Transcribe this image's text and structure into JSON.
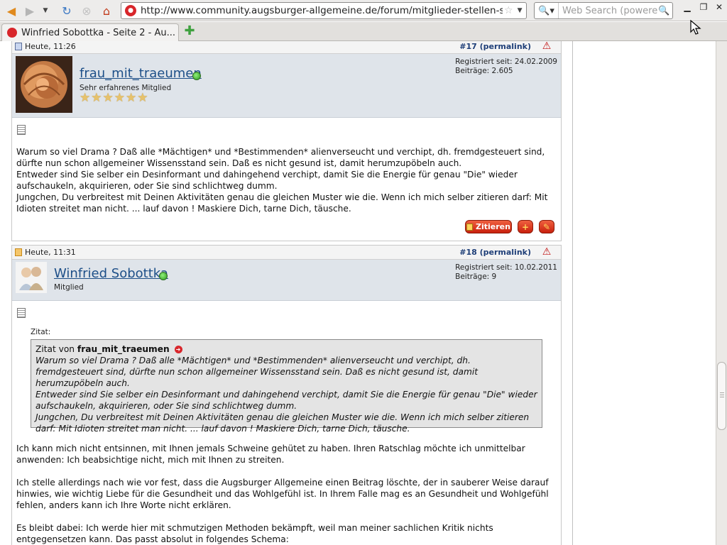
{
  "browser": {
    "url": "http://www.community.augsburger-allgemeine.de/forum/mitglieder-stellen-sic",
    "search_placeholder": "Web Search (powered",
    "tab_title": "Winfried Sobottka - Seite 2 - Au...",
    "icons": [
      "back-icon",
      "forward-icon",
      "history-dropdown-icon",
      "reload-icon",
      "stop-icon",
      "home-icon",
      "bookmark-star-icon",
      "search-engine-icon",
      "search-go-icon",
      "minimize-icon",
      "restore-icon",
      "close-icon",
      "new-tab-icon"
    ]
  },
  "posts": [
    {
      "date": "Heute, 11:26",
      "permalink": "#17 (permalink)",
      "username": "frau_mit_traeumen",
      "rank": "Sehr erfahrenes Mitglied",
      "stars": "★★★★★★",
      "registered": "Registriert seit: 24.02.2009",
      "posts_count": "Beiträge: 2.605",
      "paragraphs": [
        "Warum so viel Drama ? Daß alle *Mächtigen* und *Bestimmenden* alienverseucht und verchipt, dh. fremdgesteuert sind, dürfte nun schon allgemeiner Wissensstand sein. Daß es nicht gesund ist, damit herumzupöbeln auch.",
        "Entweder sind Sie selber ein Desinformant und dahingehend verchipt, damit Sie die Energie für genau \"Die\" wieder aufschaukeln, akquirieren, oder Sie sind schlichtweg dumm.",
        "Jungchen, Du verbreitest mit Deinen Aktivitäten genau die gleichen Muster wie die. Wenn ich mich selber zitieren darf: Mit Idioten streitet man nicht. ... lauf davon ! Maskiere Dich, tarne Dich, täusche."
      ],
      "quote_button": "Zitieren"
    },
    {
      "date": "Heute, 11:31",
      "permalink": "#18 (permalink)",
      "username": "Winfried Sobottka",
      "rank": "Mitglied",
      "registered": "Registriert seit: 10.02.2011",
      "posts_count": "Beiträge: 9",
      "quote_label": "Zitat:",
      "quote_prefix": "Zitat von",
      "quote_author": "frau_mit_traeumen",
      "quote_lines": [
        "Warum so viel Drama ? Daß alle *Mächtigen* und *Bestimmenden* alienverseucht und verchipt, dh. fremdgesteuert sind, dürfte nun schon allgemeiner Wissensstand sein. Daß es nicht gesund ist, damit herumzupöbeln auch.",
        "Entweder sind Sie selber ein Desinformant und dahingehend verchipt, damit Sie die Energie für genau \"Die\" wieder aufschaukeln, akquirieren, oder Sie sind schlichtweg dumm.",
        "Jungchen, Du verbreitest mit Deinen Aktivitäten genau die gleichen Muster wie die. Wenn ich mich selber zitieren darf: Mit Idioten streitet man nicht. ... lauf davon ! Maskiere Dich, tarne Dich, täusche."
      ],
      "paragraphs": [
        "Ich kann mich nicht entsinnen, mit Ihnen jemals Schweine gehütet zu haben. Ihren Ratschlag möchte ich unmittelbar anwenden: Ich beabsichtige nicht, mich mit Ihnen zu streiten.",
        "Ich stelle allerdings nach wie vor fest, dass die Augsburger Allgemeine einen Beitrag löschte, der in sauberer Weise darauf hinwies, wie wichtig Liebe für die Gesundheit und das Wohlgefühl ist. In Ihrem Falle mag es an Gesundheit und Wohlgefühl fehlen, anders kann ich Ihre Worte nicht erklären.",
        "Es bleibt dabei: Ich werde hier mit schmutzigen Methoden bekämpft, weil man meiner sachlichen Kritik nichts entgegensetzen kann. Das passt absolut in folgendes Schema:"
      ]
    }
  ],
  "colors": {
    "user_bar": "#dfe4ea",
    "username_link": "#1d4f88",
    "button_red": "#c8200c",
    "quote_bg": "#e4e4e4"
  }
}
